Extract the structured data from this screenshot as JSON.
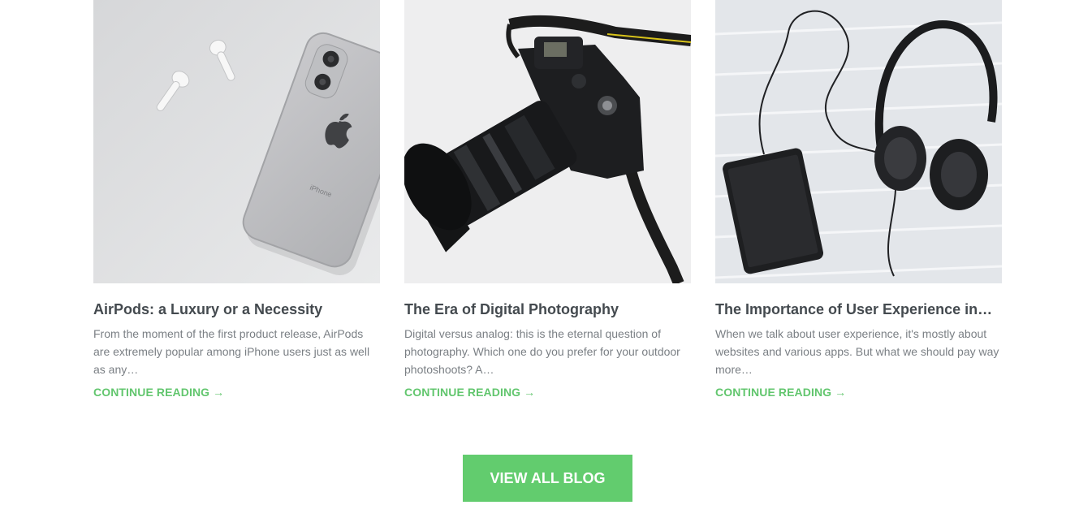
{
  "colors": {
    "accent": "#62cc6e",
    "title": "#444a4f",
    "text": "#7a7f84"
  },
  "posts": [
    {
      "image_icon": "airpods-iphone-photo",
      "title": "AirPods: a Luxury or a Necessity",
      "excerpt": "From the moment of the first product release, AirPods are extremely popular among iPhone users just as well as any…",
      "more_label": "CONTINUE READING",
      "more_arrow": "→"
    },
    {
      "image_icon": "camera-photo",
      "title": "The Era of Digital Photography",
      "excerpt": "Digital versus analog: this is the eternal question of photography. Which one do you prefer for your outdoor photoshoots? A…",
      "more_label": "CONTINUE READING",
      "more_arrow": "→"
    },
    {
      "image_icon": "headphones-phone-photo",
      "title": "The Importance of User Experience in…",
      "excerpt": "When we talk about user experience, it's mostly about websites and various apps. But what we should pay way more…",
      "more_label": "CONTINUE READING",
      "more_arrow": "→"
    }
  ],
  "view_all_label": "VIEW ALL BLOG"
}
